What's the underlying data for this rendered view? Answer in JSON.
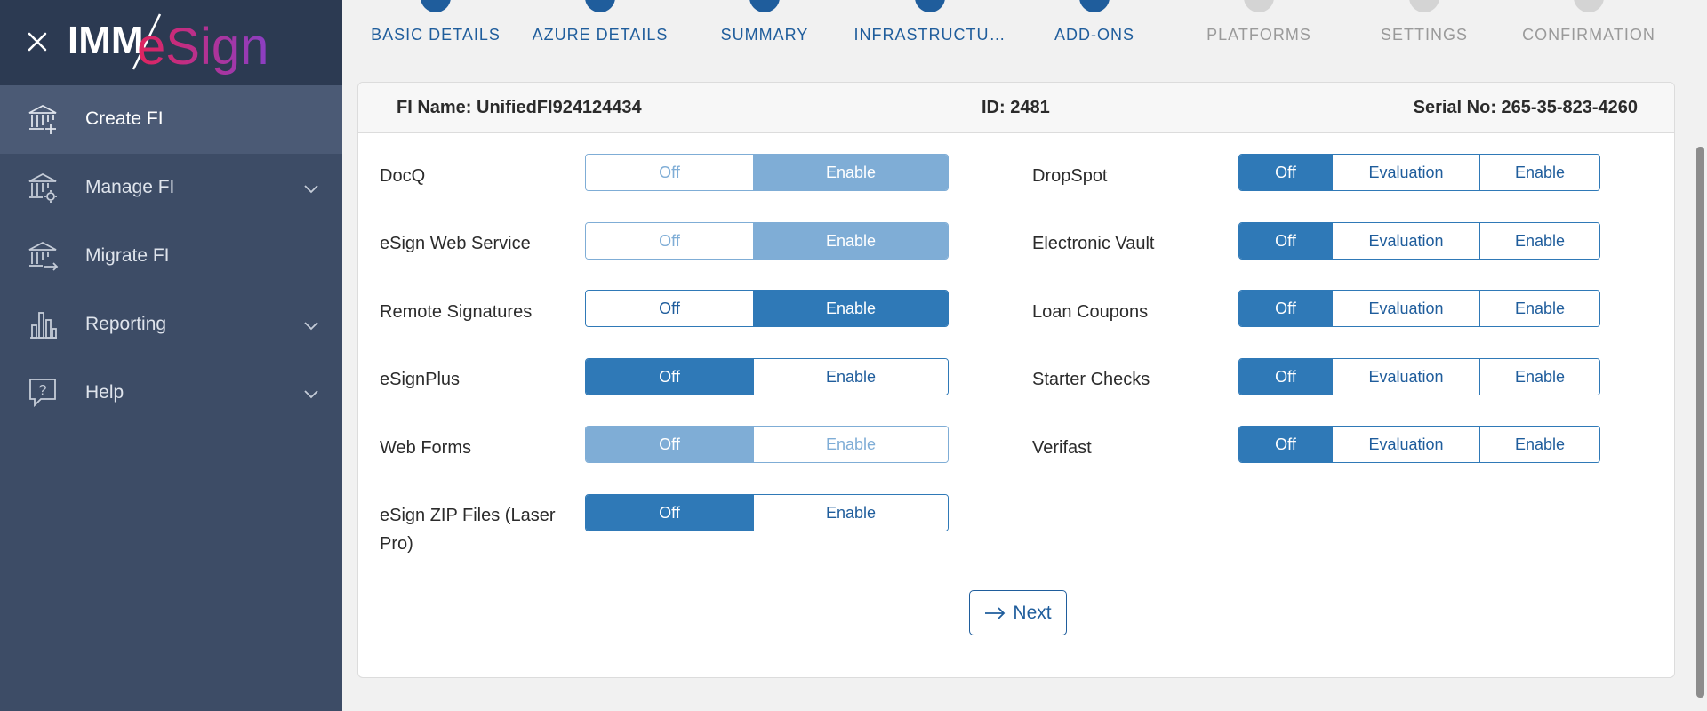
{
  "app": {
    "logo_text_imm": "IMM",
    "logo_text_esign": "eSign"
  },
  "colors": {
    "primary": "#2f79b7",
    "primary_dark": "#1f5d9c",
    "disabled": "#7fadd6",
    "sidebar_bg": "#3d4c66",
    "sidebar_top": "#2c3a52"
  },
  "sidebar": {
    "items": [
      {
        "label": "Create FI",
        "icon": "bank-add-icon",
        "active": true
      },
      {
        "label": "Manage FI",
        "icon": "bank-settings-icon",
        "expandable": true
      },
      {
        "label": "Migrate FI",
        "icon": "bank-migrate-icon"
      },
      {
        "label": "Reporting",
        "icon": "bar-chart-icon",
        "expandable": true
      },
      {
        "label": "Help",
        "icon": "help-bubble-icon",
        "expandable": true
      }
    ]
  },
  "stepper": {
    "steps": [
      {
        "label": "BASIC DETAILS",
        "state": "complete"
      },
      {
        "label": "AZURE DETAILS",
        "state": "complete"
      },
      {
        "label": "SUMMARY",
        "state": "complete"
      },
      {
        "label": "INFRASTRUCTU…",
        "state": "complete"
      },
      {
        "label": "ADD-ONS",
        "state": "current"
      },
      {
        "label": "PLATFORMS",
        "state": "pending"
      },
      {
        "label": "SETTINGS",
        "state": "pending"
      },
      {
        "label": "CONFIRMATION",
        "state": "pending"
      }
    ]
  },
  "header": {
    "fi_name": "FI Name: UnifiedFI924124434",
    "id": "ID: 2481",
    "serial": "Serial No: 265-35-823-4260"
  },
  "addons_left": [
    {
      "label": "DocQ",
      "off": "Off",
      "enable": "Enable",
      "selected": "Enable",
      "disabled": true
    },
    {
      "label": "eSign Web Service",
      "off": "Off",
      "enable": "Enable",
      "selected": "Enable",
      "disabled": true
    },
    {
      "label": "Remote Signatures",
      "off": "Off",
      "enable": "Enable",
      "selected": "Enable",
      "disabled": false
    },
    {
      "label": "eSignPlus",
      "off": "Off",
      "enable": "Enable",
      "selected": "Off",
      "disabled": false
    },
    {
      "label": "Web Forms",
      "off": "Off",
      "enable": "Enable",
      "selected": "Off",
      "disabled": true
    },
    {
      "label": "eSign ZIP Files (Laser Pro)",
      "off": "Off",
      "enable": "Enable",
      "selected": "Off",
      "disabled": false
    }
  ],
  "addons_right": [
    {
      "label": "DropSpot",
      "off": "Off",
      "evaluation": "Evaluation",
      "enable": "Enable",
      "selected": "Off"
    },
    {
      "label": "Electronic Vault",
      "off": "Off",
      "evaluation": "Evaluation",
      "enable": "Enable",
      "selected": "Off"
    },
    {
      "label": "Loan Coupons",
      "off": "Off",
      "evaluation": "Evaluation",
      "enable": "Enable",
      "selected": "Off"
    },
    {
      "label": "Starter Checks",
      "off": "Off",
      "evaluation": "Evaluation",
      "enable": "Enable",
      "selected": "Off"
    },
    {
      "label": "Verifast",
      "off": "Off",
      "evaluation": "Evaluation",
      "enable": "Enable",
      "selected": "Off"
    }
  ],
  "actions": {
    "next_label": "Next",
    "next_icon": "arrow-right-icon"
  }
}
